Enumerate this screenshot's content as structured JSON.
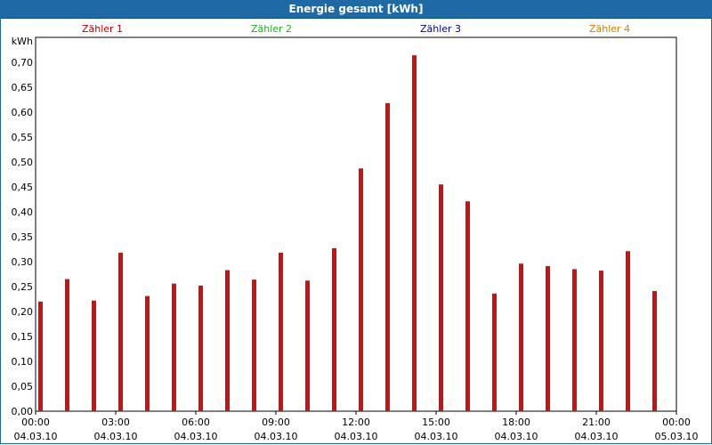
{
  "window": {
    "title": "Energie gesamt [kWh]"
  },
  "chart_data": {
    "type": "bar",
    "title": "Energie gesamt [kWh]",
    "ylabel": "kWh",
    "xlabel": "",
    "ylim": [
      0,
      0.75
    ],
    "ytick_step": 0.05,
    "ytick_labels": [
      "0,00",
      "0,05",
      "0,10",
      "0,15",
      "0,20",
      "0,25",
      "0,30",
      "0,35",
      "0,40",
      "0,45",
      "0,50",
      "0,55",
      "0,60",
      "0,65",
      "0,70"
    ],
    "xlim_hours": [
      0,
      24
    ],
    "xtick_hours": [
      0,
      3,
      6,
      9,
      12,
      15,
      18,
      21,
      24
    ],
    "xtick_labels": [
      [
        "00:00",
        "04.03.10"
      ],
      [
        "03:00",
        "04.03.10"
      ],
      [
        "06:00",
        "04.03.10"
      ],
      [
        "09:00",
        "04.03.10"
      ],
      [
        "12:00",
        "04.03.10"
      ],
      [
        "15:00",
        "04.03.10"
      ],
      [
        "18:00",
        "04.03.10"
      ],
      [
        "21:00",
        "04.03.10"
      ],
      [
        "00:00",
        "05.03.10"
      ]
    ],
    "grid": true,
    "legend_position": "top",
    "legend": [
      {
        "name": "Zähler 1",
        "color": "#c00000"
      },
      {
        "name": "Zähler 2",
        "color": "#20b020"
      },
      {
        "name": "Zähler 3",
        "color": "#0000a0"
      },
      {
        "name": "Zähler 4",
        "color": "#d08000"
      }
    ],
    "series": [
      {
        "name": "Zähler 1",
        "color": "#cc1111",
        "x_hours": [
          0,
          1,
          2,
          3,
          4,
          5,
          6,
          7,
          8,
          9,
          10,
          11,
          12,
          13,
          14,
          15,
          16,
          17,
          18,
          19,
          20,
          21,
          22,
          23
        ],
        "values": [
          0.22,
          0.265,
          0.222,
          0.318,
          0.231,
          0.256,
          0.252,
          0.283,
          0.264,
          0.318,
          0.262,
          0.327,
          0.487,
          0.618,
          0.714,
          0.455,
          0.421,
          0.236,
          0.296,
          0.291,
          0.285,
          0.282,
          0.321,
          0.241
        ]
      }
    ]
  }
}
